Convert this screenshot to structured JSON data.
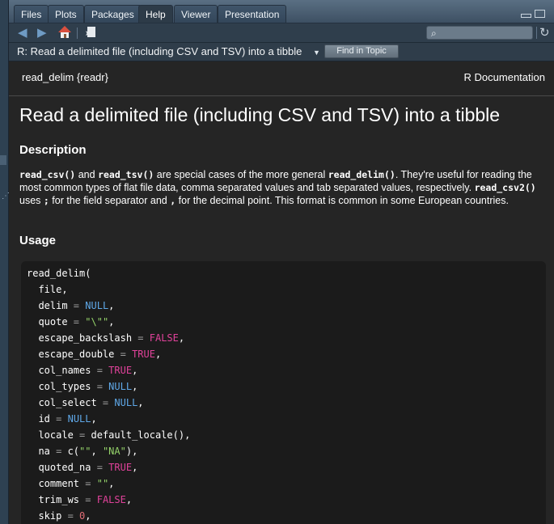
{
  "colors": {
    "null_value": "#5fa8e8",
    "bool_value": "#e0429a",
    "string_value": "#95d36a",
    "number_value": "#e06c75",
    "operator": "#9b9b9b"
  },
  "tabs": [
    {
      "label": "Files",
      "active": false
    },
    {
      "label": "Plots",
      "active": false
    },
    {
      "label": "Packages",
      "active": false
    },
    {
      "label": "Help",
      "active": true
    },
    {
      "label": "Viewer",
      "active": false
    },
    {
      "label": "Presentation",
      "active": false
    }
  ],
  "toolbar": {
    "back_icon": "arrow-left-icon",
    "forward_icon": "arrow-right-icon",
    "home_icon": "home-icon",
    "popout_icon": "show-in-new-window-icon",
    "search_icon": "search-icon",
    "search_value": "",
    "refresh_icon": "refresh-icon"
  },
  "topic_bar": {
    "title": "R: Read a delimited file (including CSV and TSV) into a tibble",
    "find_button": "Find in Topic"
  },
  "help": {
    "package": "read_delim {readr}",
    "doc_label": "R Documentation",
    "title": "Read a delimited file (including CSV and TSV) into a tibble",
    "description_heading": "Description",
    "description_segments": [
      {
        "text": "read_csv()",
        "code": true
      },
      {
        "text": " and ",
        "code": false
      },
      {
        "text": "read_tsv()",
        "code": true
      },
      {
        "text": " are special cases of the more general ",
        "code": false
      },
      {
        "text": "read_delim()",
        "code": true
      },
      {
        "text": ". They're useful for reading the most common types of flat file data, comma separated values and tab separated values, respectively. ",
        "code": false
      },
      {
        "text": "read_csv2()",
        "code": true
      },
      {
        "text": " uses ",
        "code": false
      },
      {
        "text": ";",
        "code": true
      },
      {
        "text": " for the field separator and ",
        "code": false
      },
      {
        "text": ",",
        "code": true
      },
      {
        "text": " for the decimal point. This format is common in some European countries.",
        "code": false
      }
    ],
    "usage_heading": "Usage",
    "usage_lines": [
      [
        {
          "t": "read_delim(",
          "k": "kw"
        }
      ],
      [
        {
          "t": "  file,",
          "k": "kw"
        }
      ],
      [
        {
          "t": "  delim ",
          "k": "kw"
        },
        {
          "t": "=",
          "k": "op"
        },
        {
          "t": " ",
          "k": "kw"
        },
        {
          "t": "NULL",
          "k": "null"
        },
        {
          "t": ",",
          "k": "kw"
        }
      ],
      [
        {
          "t": "  quote ",
          "k": "kw"
        },
        {
          "t": "=",
          "k": "op"
        },
        {
          "t": " ",
          "k": "kw"
        },
        {
          "t": "\"\\\"\"",
          "k": "str"
        },
        {
          "t": ",",
          "k": "kw"
        }
      ],
      [
        {
          "t": "  escape_backslash ",
          "k": "kw"
        },
        {
          "t": "=",
          "k": "op"
        },
        {
          "t": " ",
          "k": "kw"
        },
        {
          "t": "FALSE",
          "k": "bool"
        },
        {
          "t": ",",
          "k": "kw"
        }
      ],
      [
        {
          "t": "  escape_double ",
          "k": "kw"
        },
        {
          "t": "=",
          "k": "op"
        },
        {
          "t": " ",
          "k": "kw"
        },
        {
          "t": "TRUE",
          "k": "bool"
        },
        {
          "t": ",",
          "k": "kw"
        }
      ],
      [
        {
          "t": "  col_names ",
          "k": "kw"
        },
        {
          "t": "=",
          "k": "op"
        },
        {
          "t": " ",
          "k": "kw"
        },
        {
          "t": "TRUE",
          "k": "bool"
        },
        {
          "t": ",",
          "k": "kw"
        }
      ],
      [
        {
          "t": "  col_types ",
          "k": "kw"
        },
        {
          "t": "=",
          "k": "op"
        },
        {
          "t": " ",
          "k": "kw"
        },
        {
          "t": "NULL",
          "k": "null"
        },
        {
          "t": ",",
          "k": "kw"
        }
      ],
      [
        {
          "t": "  col_select ",
          "k": "kw"
        },
        {
          "t": "=",
          "k": "op"
        },
        {
          "t": " ",
          "k": "kw"
        },
        {
          "t": "NULL",
          "k": "null"
        },
        {
          "t": ",",
          "k": "kw"
        }
      ],
      [
        {
          "t": "  id ",
          "k": "kw"
        },
        {
          "t": "=",
          "k": "op"
        },
        {
          "t": " ",
          "k": "kw"
        },
        {
          "t": "NULL",
          "k": "null"
        },
        {
          "t": ",",
          "k": "kw"
        }
      ],
      [
        {
          "t": "  locale ",
          "k": "kw"
        },
        {
          "t": "=",
          "k": "op"
        },
        {
          "t": " default_locale(),",
          "k": "kw"
        }
      ],
      [
        {
          "t": "  na ",
          "k": "kw"
        },
        {
          "t": "=",
          "k": "op"
        },
        {
          "t": " c(",
          "k": "kw"
        },
        {
          "t": "\"\"",
          "k": "str"
        },
        {
          "t": ", ",
          "k": "kw"
        },
        {
          "t": "\"NA\"",
          "k": "str"
        },
        {
          "t": "),",
          "k": "kw"
        }
      ],
      [
        {
          "t": "  quoted_na ",
          "k": "kw"
        },
        {
          "t": "=",
          "k": "op"
        },
        {
          "t": " ",
          "k": "kw"
        },
        {
          "t": "TRUE",
          "k": "bool"
        },
        {
          "t": ",",
          "k": "kw"
        }
      ],
      [
        {
          "t": "  comment ",
          "k": "kw"
        },
        {
          "t": "=",
          "k": "op"
        },
        {
          "t": " ",
          "k": "kw"
        },
        {
          "t": "\"\"",
          "k": "str"
        },
        {
          "t": ",",
          "k": "kw"
        }
      ],
      [
        {
          "t": "  trim_ws ",
          "k": "kw"
        },
        {
          "t": "=",
          "k": "op"
        },
        {
          "t": " ",
          "k": "kw"
        },
        {
          "t": "FALSE",
          "k": "bool"
        },
        {
          "t": ",",
          "k": "kw"
        }
      ],
      [
        {
          "t": "  skip ",
          "k": "kw"
        },
        {
          "t": "=",
          "k": "op"
        },
        {
          "t": " ",
          "k": "kw"
        },
        {
          "t": "0",
          "k": "num"
        },
        {
          "t": ",",
          "k": "kw"
        }
      ]
    ]
  }
}
